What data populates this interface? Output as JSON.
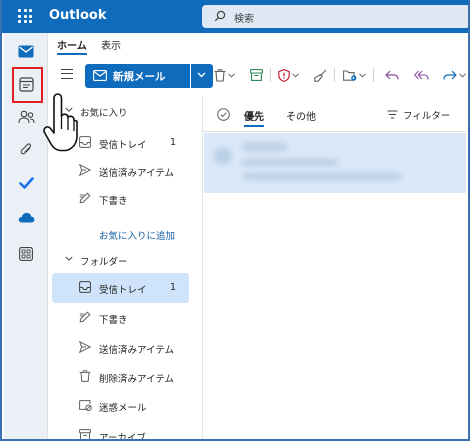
{
  "app": {
    "name": "Outlook",
    "search_placeholder": "検索"
  },
  "ribbon_tabs": {
    "home": "ホーム",
    "view": "表示"
  },
  "ribbon": {
    "new_mail_label": "新規メール"
  },
  "favorites": {
    "header": "お気に入り",
    "items": [
      {
        "label": "受信トレイ",
        "count": "1",
        "icon": "inbox-icon"
      },
      {
        "label": "送信済みアイテム",
        "count": "",
        "icon": "send-icon"
      },
      {
        "label": "下書き",
        "count": "",
        "icon": "draft-icon"
      }
    ],
    "add_link": "お気に入りに追加"
  },
  "folders": {
    "header": "フォルダー",
    "items": [
      {
        "label": "受信トレイ",
        "count": "1",
        "icon": "inbox-icon",
        "selected": true
      },
      {
        "label": "下書き",
        "count": "",
        "icon": "draft-icon"
      },
      {
        "label": "送信済みアイテム",
        "count": "",
        "icon": "send-icon"
      },
      {
        "label": "削除済みアイテム",
        "count": "",
        "icon": "trash-icon"
      },
      {
        "label": "迷惑メール",
        "count": "",
        "icon": "junk-icon"
      },
      {
        "label": "アーカイブ",
        "count": "",
        "icon": "archive-icon"
      }
    ]
  },
  "message_list": {
    "tab_focused": "優先",
    "tab_other": "その他",
    "filter_label": "フィルター"
  },
  "colors": {
    "brand": "#0f6cbd",
    "selected_bg": "#cfe4fa",
    "highlight_box": "#e32020"
  }
}
